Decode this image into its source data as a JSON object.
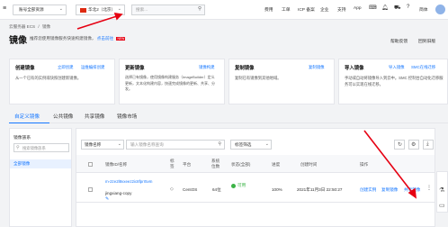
{
  "topbar": {
    "resource_group": "账号全部资源",
    "region": "华北2（北京）",
    "search_placeholder": "搜索...",
    "links": [
      "费用",
      "工单",
      "ICP 备案",
      "企业",
      "支持",
      "App"
    ],
    "user": "简体"
  },
  "breadcrumb": {
    "root": "云服务器 ECS",
    "sep": "/",
    "current": "镜像"
  },
  "page": {
    "title": "镜像",
    "subtitle": "推荐您使用镜像服务快速构建镜像，",
    "subtitle_link": "点击前往",
    "badge": "NEW",
    "right_links": [
      "帮助反馈",
      "回到旧版"
    ]
  },
  "cards": [
    {
      "title": "创建镜像",
      "links": [
        "立即创建",
        "运维编排创建"
      ],
      "desc": "从一个已有的实例或快照创建新镜像。"
    },
    {
      "title": "更新镜像",
      "links": [
        "镜像构建"
      ],
      "desc": "选择已有镜像，使用镜像构建服务（ImageBuilder）定义更新，文本化构建内容，快速完成镜像的更新、共享、分发。"
    },
    {
      "title": "复制镜像",
      "links": [
        "复制镜像"
      ],
      "desc": "复制已有镜像到其他地域。"
    },
    {
      "title": "导入镜像",
      "links": [
        "导入镜像",
        "SMC在线迁移"
      ],
      "desc": "手动或自动将镜像导入到云中。SMC 控制台自动化迁移服务可以实现在线迁移。"
    }
  ],
  "tabs": [
    "自定义镜像",
    "公共镜像",
    "共享镜像",
    "镜像市场"
  ],
  "sidebar": {
    "title": "镜像族系",
    "search_placeholder": "搜索镜像族系",
    "item": "全部镜像"
  },
  "filters": {
    "field": "镜像名称",
    "placeholder": "输入镜像名称查询",
    "tag_filter": "标签筛选"
  },
  "table": {
    "headers": [
      "镜像ID/名称",
      "标签",
      "平台",
      "系统位数",
      "状态(全部)",
      "进度",
      "创建时间",
      "操作"
    ],
    "rows": [
      {
        "id": "m-2ze2l8vxeez2ic8fprr5vm",
        "name": "jingxiang-copy",
        "platform": "CentOS",
        "bits": "64位",
        "status": "可用",
        "progress": "100%",
        "created": "2021年11月3日 22:50:27",
        "actions": [
          "创建实例",
          "复制镜像",
          "共享镜像"
        ]
      }
    ]
  },
  "colors": {
    "accent": "#1677ff",
    "arrow": "#e60012",
    "ok": "#3bb346"
  }
}
